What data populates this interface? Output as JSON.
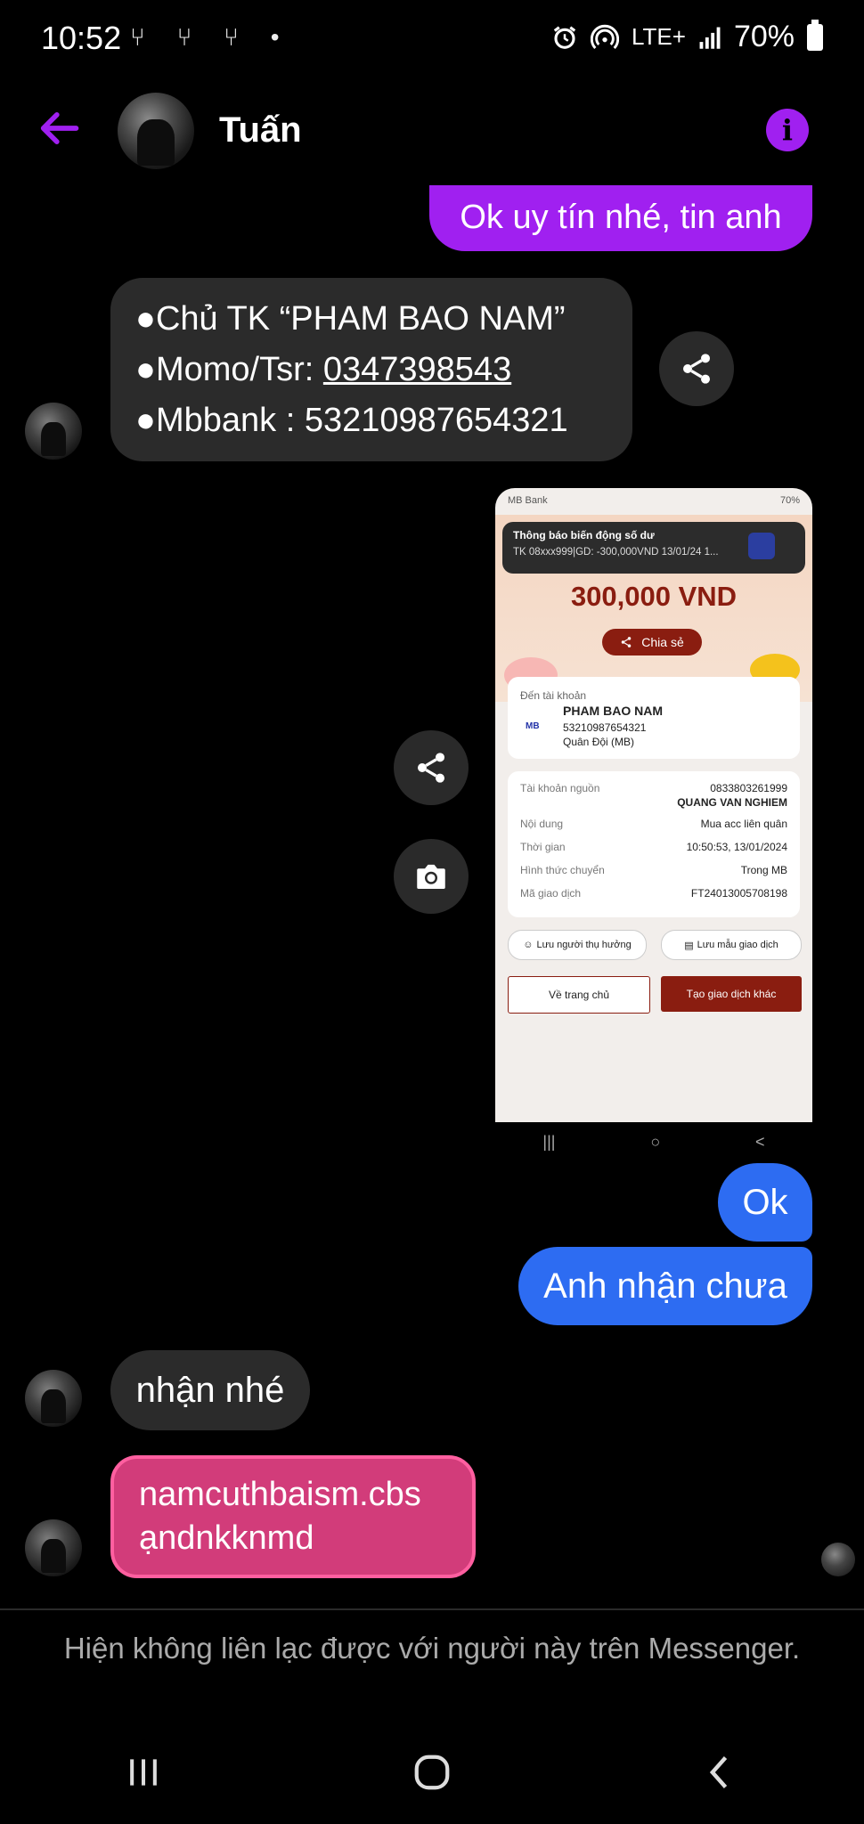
{
  "status_bar": {
    "time": "10:52",
    "left_icons": "⑂ ⑂ ⑂ •",
    "network": "LTE+",
    "battery": "70%"
  },
  "header": {
    "contact_name": "Tuấn",
    "info_label": "i"
  },
  "messages": {
    "m1": "Ok uy tín nhé, tin anh",
    "m2": {
      "line1": "●Chủ TK “PHAM BAO NAM”",
      "line2_prefix": "●Momo/Tsr: ",
      "line2_phone": "0347398543",
      "line3": "●Mbbank : 53210987654321"
    },
    "m4": "Ok",
    "m5": "Anh nhận chưa",
    "m6": "nhận nhé",
    "m7": {
      "line1": "namcuthbaism.cbs",
      "line2": "ạndnkknmd"
    }
  },
  "screenshot": {
    "status_app": "MB Bank",
    "status_right": "70%",
    "notif_title": "Thông báo biến động số dư",
    "notif_body": "TK 08xxx999|GD: -300,000VND 13/01/24 1...",
    "amount": "300,000 VND",
    "share_label": "Chia sẻ",
    "to_account_label": "Đến tài khoản",
    "bank_logo": "MB",
    "recipient_name": "PHAM BAO NAM",
    "recipient_account": "53210987654321",
    "recipient_bank": "Quân Đội (MB)",
    "rows": [
      {
        "k": "Tài khoản nguồn",
        "v": "0833803261999"
      },
      {
        "k": "Nội dung",
        "v": "Mua acc liên quân"
      },
      {
        "k": "Thời gian",
        "v": "10:50:53, 13/01/2024"
      },
      {
        "k": "Hình thức chuyển",
        "v": "Trong MB"
      },
      {
        "k": "Mã giao dịch",
        "v": "FT24013005708198"
      }
    ],
    "source_name": "QUANG VAN NGHIEM",
    "chip1": "Lưu người thụ hưởng",
    "chip2": "Lưu mẫu giao dịch",
    "btn_home": "Về trang chủ",
    "btn_new": "Tạo giao dịch khác",
    "nav": [
      "|||",
      "○",
      "<"
    ]
  },
  "footer": {
    "notice": "Hiện không liên lạc được với người này trên Messenger."
  },
  "colors": {
    "accent_purple": "#a020f0",
    "bubble_blue": "#2d6cf2",
    "bubble_gray": "#2b2b2b",
    "bubble_pink": "#d23c7a",
    "mb_red": "#8a1d10"
  }
}
